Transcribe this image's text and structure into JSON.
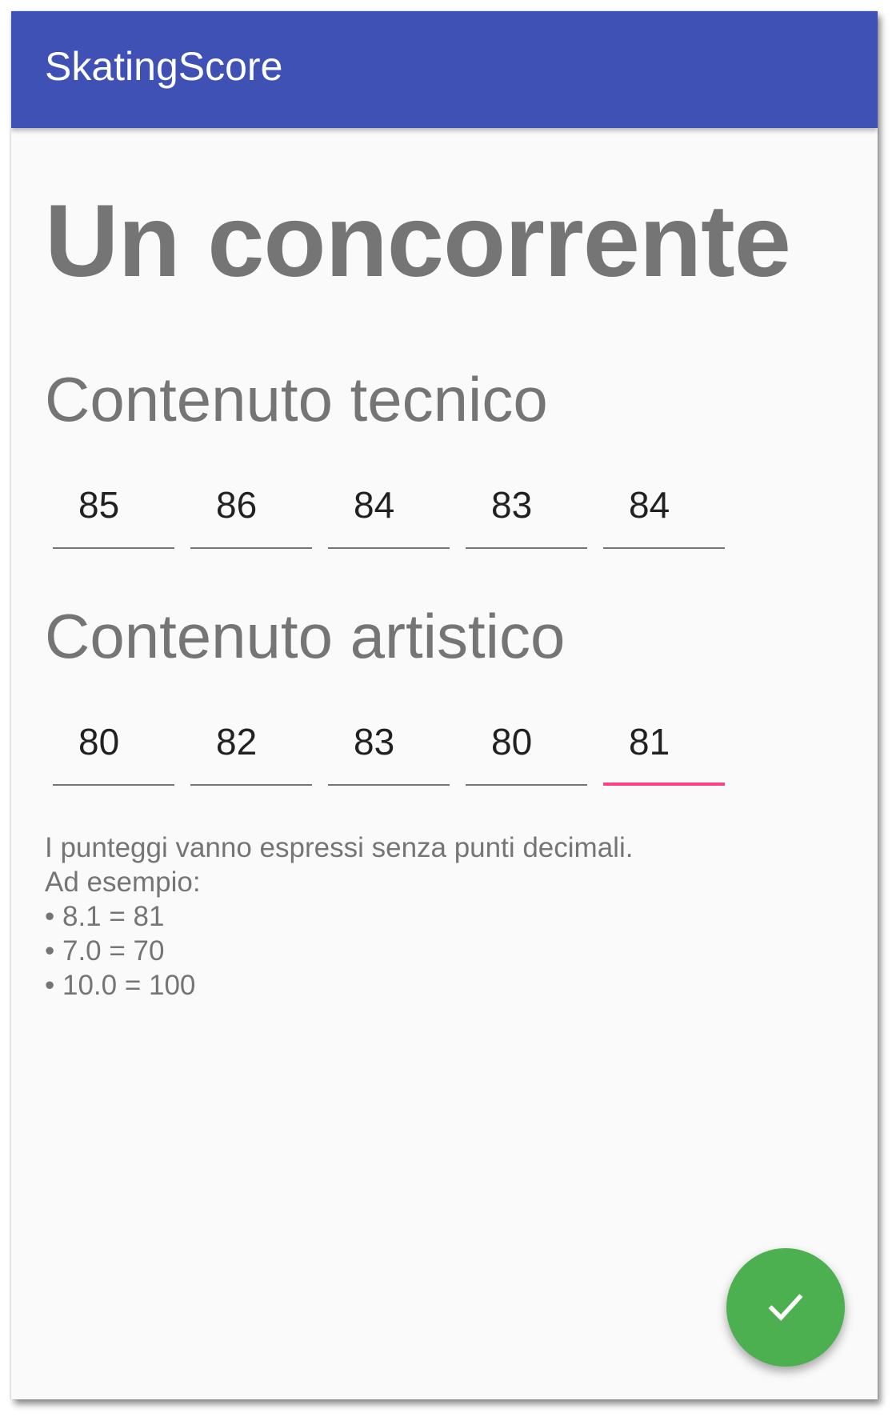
{
  "app_bar": {
    "title": "SkatingScore",
    "color": "#3f51b5"
  },
  "page": {
    "title": "Un concorrente"
  },
  "technical": {
    "heading": "Contenuto tecnico",
    "scores": [
      "85",
      "86",
      "84",
      "83",
      "84"
    ]
  },
  "artistic": {
    "heading": "Contenuto artistico",
    "scores": [
      "80",
      "82",
      "83",
      "80",
      "81"
    ],
    "focused_index": 4
  },
  "hint": {
    "lines": [
      "I punteggi vanno espressi senza punti decimali.",
      "Ad esempio:",
      "• 8.1 = 81",
      "• 7.0 = 70",
      "• 10.0 = 100"
    ]
  },
  "fab": {
    "icon": "check-icon",
    "color": "#4caf50"
  },
  "accent_color": "#ff4081"
}
